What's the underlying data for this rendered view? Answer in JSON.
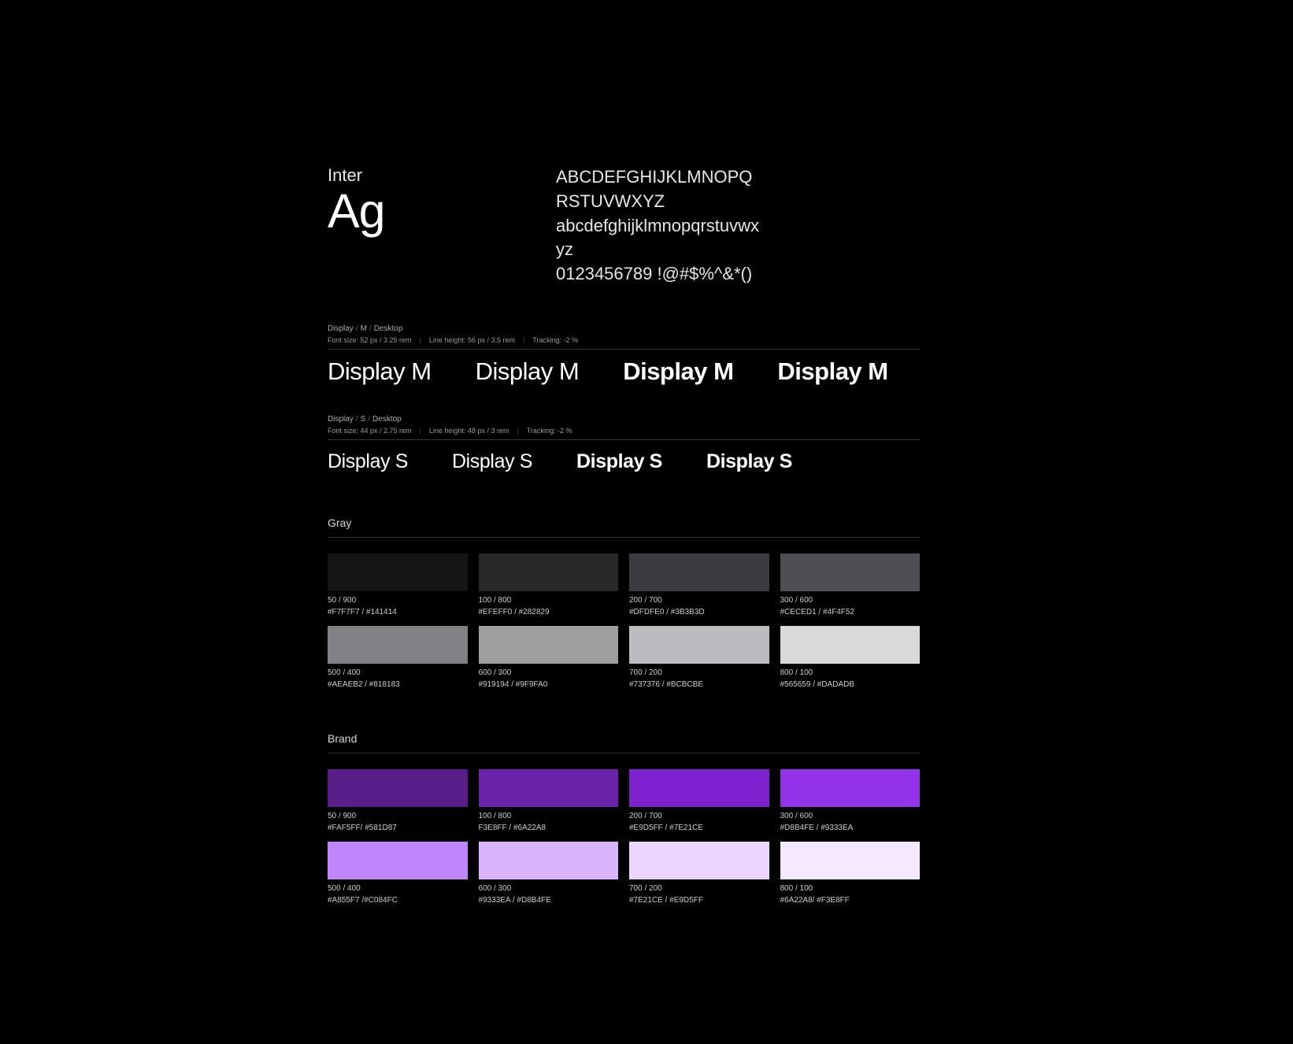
{
  "font": {
    "name": "Inter",
    "specimen": "Ag",
    "alphabet_upper": "ABCDEFGHIJKLMNOPQRSTUVWXYZ",
    "alphabet_lower": "abcdefghijklmnopqrstuvwxyz",
    "alphabet_digits_symbols": "0123456789 !@#$%^&*()"
  },
  "typeScales": {
    "displayM": {
      "breadcrumb": {
        "p1": "Display",
        "p2": "M",
        "p3": "Desktop"
      },
      "meta": {
        "fontSize": "Font size: 52 px / 3.25 rem",
        "lineHeight": "Line height: 56 px / 3.5 rem",
        "tracking": "Tracking: -2 %"
      },
      "sample": "Display M"
    },
    "displayS": {
      "breadcrumb": {
        "p1": "Display",
        "p2": "S",
        "p3": "Desktop"
      },
      "meta": {
        "fontSize": "Font size: 44 px / 2.75 rem",
        "lineHeight": "Line height: 48 px / 3 rem",
        "tracking": "Tracking: -2 %"
      },
      "sample": "Display S"
    }
  },
  "palettes": {
    "gray": {
      "title": "Gray",
      "swatches": [
        {
          "name": "50 / 900",
          "hex": "#F7F7F7 / #141414",
          "color": "#141414"
        },
        {
          "name": "100 / 800",
          "hex": "#EFEFF0 / #282829",
          "color": "#282829"
        },
        {
          "name": "200 / 700",
          "hex": "#DFDFE0 / #3B3B3D",
          "color": "#3B3B3D"
        },
        {
          "name": "300 / 600",
          "hex": "#CECED1 / #4F4F52",
          "color": "#4F4F52"
        },
        {
          "name": "500 / 400",
          "hex": "#AEAEB2 / #818183",
          "color": "#818183"
        },
        {
          "name": "600 / 300",
          "hex": "#919194 / #9F9FA0",
          "color": "#9F9FA0"
        },
        {
          "name": "700 / 200",
          "hex": "#737376 / #BCBCBE",
          "color": "#BCBCBE"
        },
        {
          "name": "800 / 100",
          "hex": "#565659 / #DADADB",
          "color": "#DADADB"
        }
      ]
    },
    "brand": {
      "title": "Brand",
      "swatches": [
        {
          "name": "50 / 900",
          "hex": "#FAF5FF/ #581D87",
          "color": "#581D87"
        },
        {
          "name": "100 / 800",
          "hex": "F3E8FF / #6A22A8",
          "color": "#6A22A8"
        },
        {
          "name": "200 / 700",
          "hex": "#E9D5FF / #7E21CE",
          "color": "#7E21CE"
        },
        {
          "name": "300 / 600",
          "hex": "#D8B4FE / #9333EA",
          "color": "#9333EA"
        },
        {
          "name": "500 / 400",
          "hex": "#A855F7 /#C084FC",
          "color": "#C084FC"
        },
        {
          "name": "600 / 300",
          "hex": "#9333EA / #D8B4FE",
          "color": "#D8B4FE"
        },
        {
          "name": "700 / 200",
          "hex": "#7E21CE / #E9D5FF",
          "color": "#E9D5FF"
        },
        {
          "name": "800 / 100",
          "hex": "#6A22A8/ #F3E8FF",
          "color": "#F3E8FF"
        }
      ]
    }
  }
}
